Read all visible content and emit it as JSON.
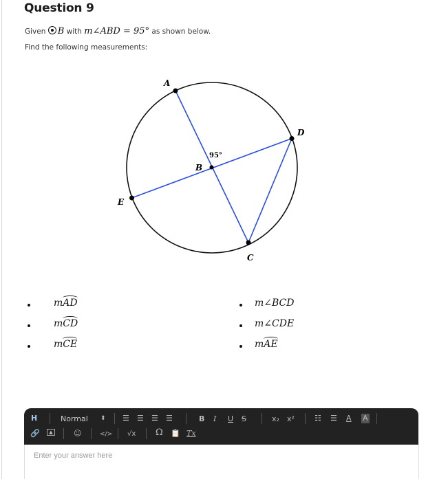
{
  "question": {
    "title": "Question 9",
    "given_prefix": "Given",
    "circle_name": "B",
    "given_with": "with",
    "angle_expr": "m∠ABD = 95°",
    "given_suffix": "as shown below.",
    "instruction": "Find the following measurements:"
  },
  "diagram": {
    "points": {
      "A": "A",
      "B": "B",
      "C": "C",
      "D": "D",
      "E": "E"
    },
    "angle_label": "95°",
    "colors": {
      "circle": "#111111",
      "segments": "#2a4fe0",
      "points": "#000000"
    }
  },
  "items_left": [
    {
      "prefix": "m",
      "arc": "AD"
    },
    {
      "prefix": "m",
      "arc": "CD"
    },
    {
      "prefix": "m",
      "arc": "CE"
    }
  ],
  "items_right": [
    {
      "text": "m∠BCD"
    },
    {
      "text": "m∠CDE"
    },
    {
      "prefix": "m",
      "arc": "AE"
    }
  ],
  "toolbar": {
    "heading": "H",
    "format_select": "Normal",
    "bold": "B",
    "italic": "I",
    "underline": "U",
    "strike": "S",
    "subscript": "x₂",
    "superscript": "x²",
    "code": "</>",
    "formula": "√x",
    "special_char": "Ω",
    "clear_format": "Tx"
  },
  "editor": {
    "placeholder": "Enter your answer here"
  }
}
